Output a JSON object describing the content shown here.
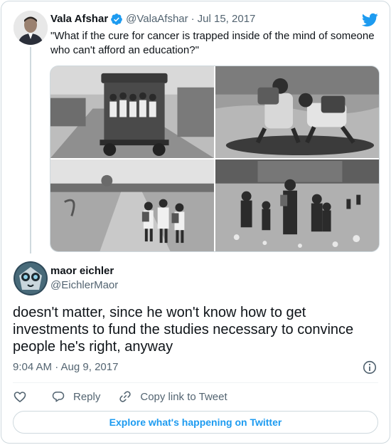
{
  "parent_tweet": {
    "author_name": "Vala Afshar",
    "author_handle": "@ValaAfshar",
    "separator": "·",
    "date": "Jul 15, 2017",
    "text": "\"What if the cure for cancer is trapped inside of the mind of someone who can't afford an education?\"",
    "media": [
      {
        "icon": "photo-children-on-cart"
      },
      {
        "icon": "photo-children-crossing-water"
      },
      {
        "icon": "photo-children-walking-path"
      },
      {
        "icon": "photo-children-walking-village"
      }
    ]
  },
  "reply_tweet": {
    "author_name": "maor eichler",
    "author_handle": "@EichlerMaor",
    "text": "doesn't matter, since he won't know how to get investments to fund the studies necessary to convince people he's right, anyway",
    "timestamp": "9:04 AM · Aug 9, 2017"
  },
  "actions": {
    "reply_label": "Reply",
    "copy_link_label": "Copy link to Tweet"
  },
  "explore_label": "Explore what's happening on Twitter",
  "colors": {
    "accent": "#1d9bf0",
    "text": "#0f1419",
    "muted": "#536471",
    "border": "#cfd9de"
  }
}
